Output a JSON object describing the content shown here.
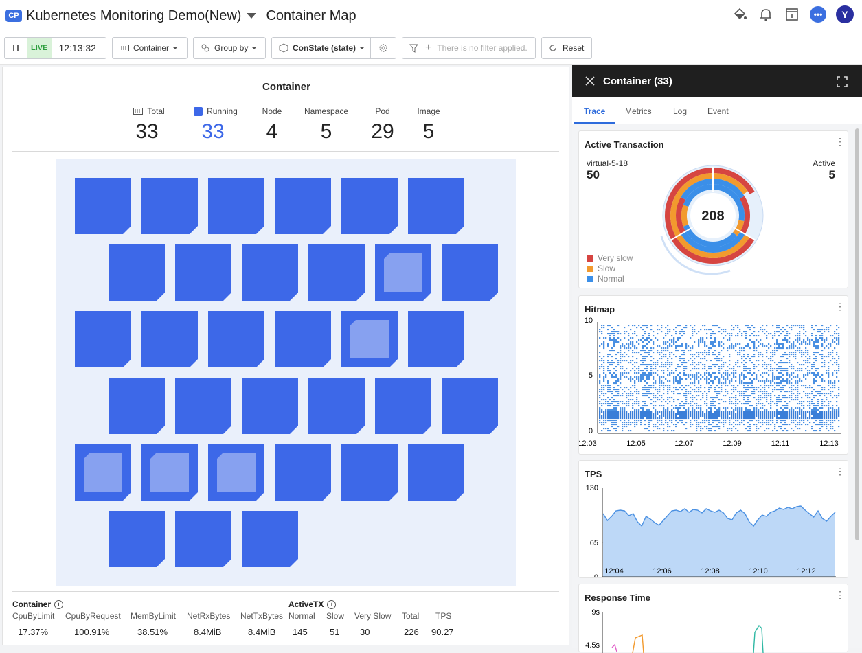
{
  "header": {
    "badge": "CP",
    "project": "Kubernetes Monitoring Demo(New)",
    "page_title": "Container Map",
    "icons": [
      "paint-bucket-icon",
      "bell-icon",
      "document-info-icon",
      "chat-icon"
    ],
    "avatar_initial": "Y"
  },
  "toolbar": {
    "live_label": "LIVE",
    "time": "12:13:32",
    "view_label": "Container",
    "group_label": "Group by",
    "state_label": "ConState (state)",
    "filter_placeholder": "There is no filter applied.",
    "reset_label": "Reset"
  },
  "summary": {
    "title": "Container",
    "stats": [
      {
        "label": "Total",
        "value": "33"
      },
      {
        "label": "Running",
        "value": "33"
      },
      {
        "label": "Node",
        "value": "4"
      },
      {
        "label": "Namespace",
        "value": "5"
      },
      {
        "label": "Pod",
        "value": "29"
      },
      {
        "label": "Image",
        "value": "5"
      }
    ]
  },
  "map": {
    "container_count": 33,
    "highlighted_cells": [
      10,
      16,
      24,
      25,
      26
    ],
    "colors": {
      "cell": "#3d68e8",
      "highlight_inner": "#87a1f0",
      "background": "#eaf0fb"
    }
  },
  "bottom": {
    "container_header": "Container",
    "activetx_header": "ActiveTX",
    "metrics": [
      {
        "label": "CpuByLimit",
        "value": "17.37%"
      },
      {
        "label": "CpuByRequest",
        "value": "100.91%"
      },
      {
        "label": "MemByLimit",
        "value": "38.51%"
      },
      {
        "label": "NetRxBytes",
        "value": "8.4MiB"
      },
      {
        "label": "NetTxBytes",
        "value": "8.4MiB"
      },
      {
        "label": "Normal",
        "value": "145"
      },
      {
        "label": "Slow",
        "value": "51"
      },
      {
        "label": "Very Slow",
        "value": "30"
      },
      {
        "label": "Total",
        "value": "226"
      },
      {
        "label": "TPS",
        "value": "90.27"
      }
    ]
  },
  "panel": {
    "title": "Container (33)",
    "tabs": [
      "Trace",
      "Metrics",
      "Log",
      "Event"
    ],
    "active_tab": "Trace"
  },
  "active_transaction": {
    "title": "Active Transaction",
    "left_label": "virtual-5-18",
    "left_value": "50",
    "right_label": "Active",
    "right_value": "5",
    "center_value": "208",
    "legend": [
      {
        "label": "Very slow",
        "color": "#d64541"
      },
      {
        "label": "Slow",
        "color": "#f29a2e"
      },
      {
        "label": "Normal",
        "color": "#3b8fe8"
      }
    ]
  },
  "chart_data": [
    {
      "type": "heatmap",
      "title": "Hitmap",
      "ylim": [
        0,
        10
      ],
      "yticks": [
        "10",
        "5",
        "0"
      ],
      "xticks": [
        "12:03",
        "12:05",
        "12:07",
        "12:09",
        "12:11",
        "12:13"
      ]
    },
    {
      "type": "area",
      "title": "TPS",
      "ylim": [
        0,
        130
      ],
      "yticks": [
        "130",
        "65",
        "0"
      ],
      "xticks": [
        "12:04",
        "12:06",
        "12:08",
        "12:10",
        "12:12"
      ],
      "x_range": [
        "12:03:30",
        "12:13:30"
      ],
      "values": [
        92,
        82,
        88,
        96,
        97,
        96,
        89,
        92,
        80,
        74,
        88,
        84,
        79,
        75,
        82,
        89,
        96,
        97,
        95,
        99,
        94,
        98,
        97,
        93,
        99,
        96,
        94,
        97,
        93,
        85,
        83,
        93,
        97,
        92,
        80,
        74,
        83,
        90,
        88,
        94,
        96,
        100,
        98,
        101,
        99,
        102,
        103,
        97,
        92,
        87,
        96,
        85,
        81,
        88,
        94
      ]
    },
    {
      "type": "line",
      "title": "Response Time",
      "yticks": [
        "9s",
        "4.5s"
      ]
    }
  ],
  "icon_names": {
    "pause": "pause-icon",
    "settings": "gear-icon",
    "filter": "filter-icon",
    "reset": "refresh-icon",
    "close": "close-icon",
    "expand": "expand-icon"
  }
}
